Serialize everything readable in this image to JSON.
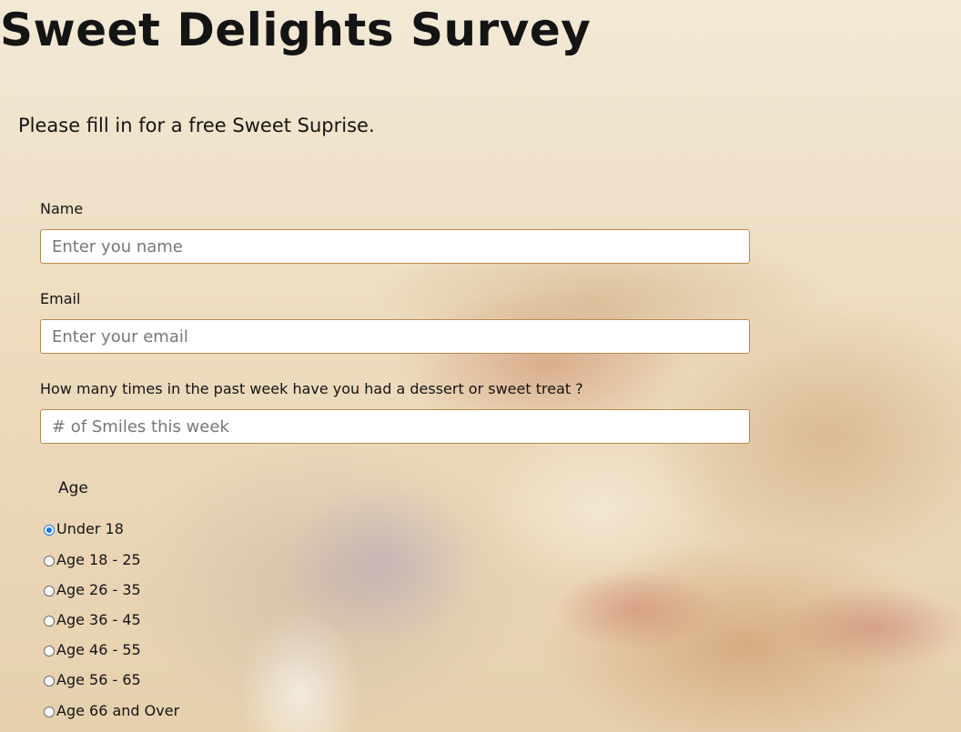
{
  "header": {
    "title": "Sweet Delights Survey",
    "subtitle": "Please fill in for a free Sweet Suprise."
  },
  "form": {
    "name": {
      "label": "Name",
      "placeholder": "Enter you name",
      "value": ""
    },
    "email": {
      "label": "Email",
      "placeholder": "Enter your email",
      "value": ""
    },
    "treats": {
      "label": "How many times in the past week have you had a dessert or sweet treat ?",
      "placeholder": "# of Smiles this week",
      "value": ""
    },
    "age": {
      "legend": "Age",
      "selected": "Under 18",
      "options": [
        "Under 18",
        "Age 18 - 25",
        "Age 26 - 35",
        "Age 36 - 45",
        "Age 46 - 55",
        "Age 56 - 65",
        "Age 66 and Over"
      ]
    }
  },
  "colors": {
    "background": "#efe3ca",
    "input_border": "#b98b4e",
    "radio_accent": "#1a73e8",
    "text": "#141414"
  }
}
